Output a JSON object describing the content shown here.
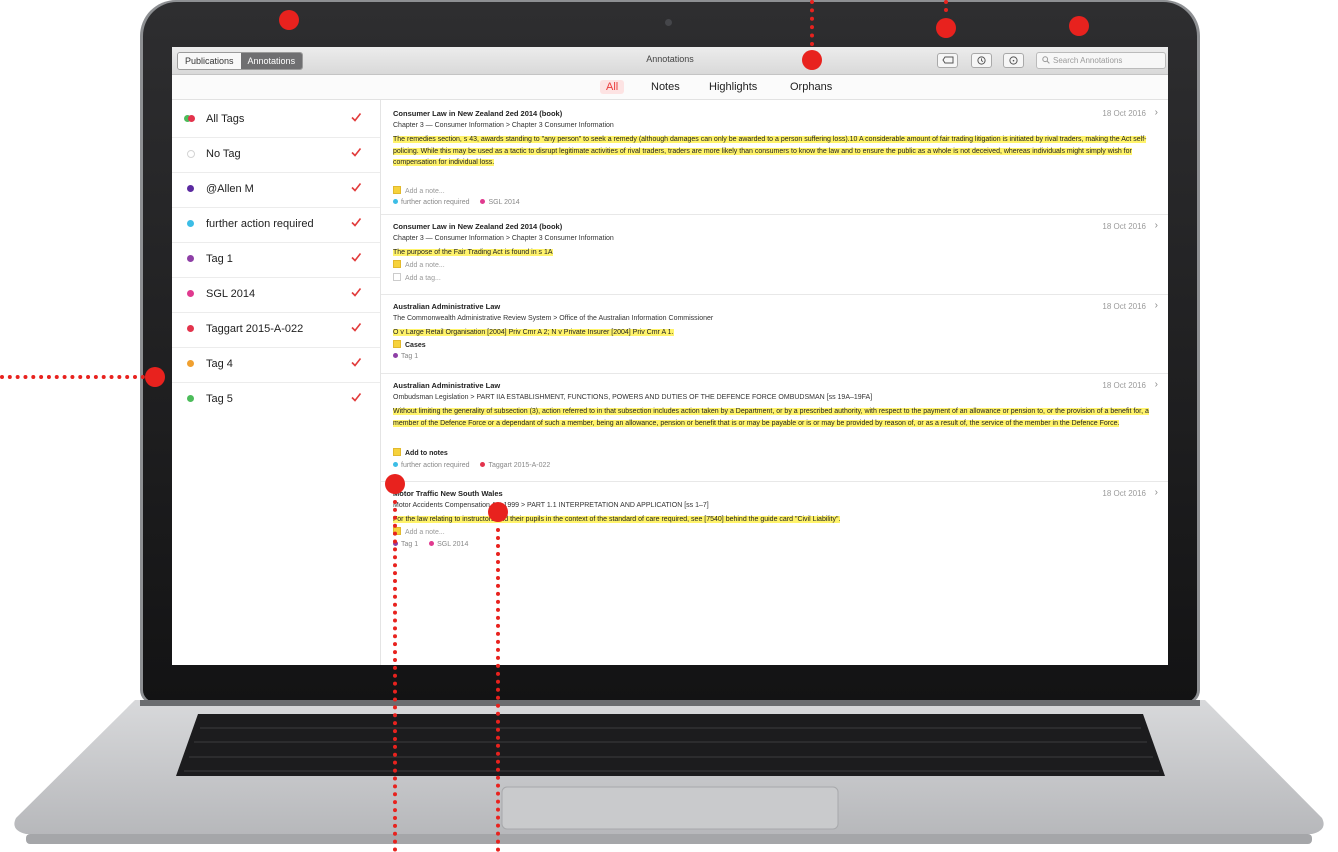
{
  "toolbar": {
    "tab_publications": "Publications",
    "tab_annotations": "Annotations",
    "title": "Annotations",
    "search_placeholder": "Search Annotations"
  },
  "filters": [
    "All",
    "Notes",
    "Highlights",
    "Orphans"
  ],
  "colors": {
    "accent": "#e8221e",
    "highlight": "#fff36b",
    "check": "#e23b3b"
  },
  "sidebar": {
    "tags": [
      {
        "label": "All Tags",
        "color": "multi"
      },
      {
        "label": "No Tag",
        "color": "#ffffff"
      },
      {
        "label": "@Allen M",
        "color": "#5b2aa0"
      },
      {
        "label": "further action required",
        "color": "#3cbde6"
      },
      {
        "label": "Tag 1",
        "color": "#8e3fa6"
      },
      {
        "label": "SGL 2014",
        "color": "#e03a8f"
      },
      {
        "label": "Taggart 2015-A-022",
        "color": "#e3334c"
      },
      {
        "label": "Tag 4",
        "color": "#f0a030"
      },
      {
        "label": "Tag 5",
        "color": "#4cbc5a"
      }
    ]
  },
  "annotations": [
    {
      "title": "Consumer Law in New Zealand 2ed 2014 (book)",
      "date": "18 Oct 2016",
      "path": "Chapter 3 — Consumer Information > Chapter 3 Consumer Information",
      "highlight": "The remedies section, s 43, awards standing to \"any person\" to seek a remedy (although damages can only be awarded to a person suffering loss).10 A considerable amount of fair trading litigation is initiated by rival traders, making the Act self-policing. While this may be used as a tactic to disrupt legitimate activities of rival traders, traders are more likely than consumers to know the law and to ensure the public as a whole is not deceived, whereas individuals might simply wish for compensation for individual loss.",
      "note": "Add a note...",
      "tags": [
        {
          "label": "further action required",
          "color": "#3cbde6"
        },
        {
          "label": "SGL 2014",
          "color": "#e03a8f"
        }
      ]
    },
    {
      "title": "Consumer Law in New Zealand 2ed 2014 (book)",
      "date": "18 Oct 2016",
      "path": "Chapter 3 — Consumer Information > Chapter 3 Consumer Information",
      "highlight": "The purpose of the Fair Trading Act is found in s 1A",
      "note": "Add a note...",
      "add_tag": "Add a tag..."
    },
    {
      "title": "Australian Administrative Law",
      "date": "18 Oct 2016",
      "path": "The Commonwealth Administrative Review System > Office of the Australian Information Commissioner",
      "highlight": "O v Large Retail Organisation  [2004] Priv Cmr A 2; N v Private Insurer  [2004] Priv Cmr A 1.",
      "note": "Cases",
      "tags": [
        {
          "label": "Tag 1",
          "color": "#8e3fa6"
        }
      ]
    },
    {
      "title": "Australian Administrative Law",
      "date": "18 Oct 2016",
      "path": "Ombudsman Legislation > PART IIA ESTABLISHMENT, FUNCTIONS, POWERS AND DUTIES OF THE DEFENCE FORCE OMBUDSMAN [ss 19A–19FA]",
      "highlight": "Without limiting the generality of subsection (3), action referred to in that subsection includes action taken by a Department, or by a prescribed authority, with respect to the payment of an allowance or pension to, or the provision of a benefit for, a member of the Defence Force or a dependant of such a member, being an allowance, pension or benefit that is or may be payable or is or may be provided by reason of, or as a result of, the service of the member in the Defence Force.",
      "note": "Add to notes",
      "tags": [
        {
          "label": "further action required",
          "color": "#3cbde6"
        },
        {
          "label": "Taggart 2015-A-022",
          "color": "#e3334c"
        }
      ]
    },
    {
      "title": "Motor Traffic New South Wales",
      "date": "18 Oct 2016",
      "path": "Motor Accidents Compensation Act 1999 > PART 1.1 INTERPRETATION AND APPLICATION [ss 1–7]",
      "highlight": "For the law relating to instructors and their pupils in the context of the standard of care required, see [7540] behind the guide card \"Civil Liability\".",
      "note": "Add a note...",
      "tags": [
        {
          "label": "Tag 1",
          "color": "#8e3fa6"
        },
        {
          "label": "SGL 2014",
          "color": "#e03a8f"
        }
      ]
    }
  ]
}
